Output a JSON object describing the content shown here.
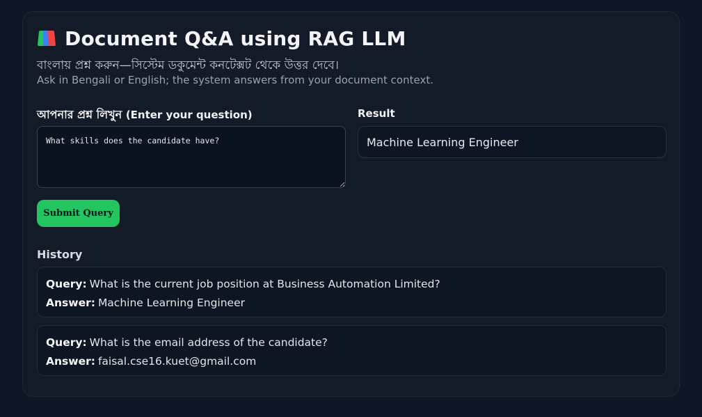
{
  "header": {
    "icon": "books-icon",
    "title": "Document Q&A using RAG LLM",
    "subtitle_bn": "বাংলায় প্রশ্ন করুন—সিস্টেম ডকুমেন্ট কনটেক্সট থেকে উত্তর দেবে।",
    "subtitle_en": "Ask in Bengali or English; the system answers from your document context."
  },
  "question": {
    "label_bn": "আপনার প্রশ্ন লিখুন",
    "label_en": "(Enter your question)",
    "value": "What skills does the candidate have?"
  },
  "submit": {
    "label": "Submit Query"
  },
  "result": {
    "label": "Result",
    "value": "Machine Learning Engineer"
  },
  "history": {
    "label": "History",
    "query_key": "Query:",
    "answer_key": "Answer:",
    "items": [
      {
        "query": "What is the current job position at Business Automation Limited?",
        "answer": "Machine Learning Engineer"
      },
      {
        "query": "What is the email address of the candidate?",
        "answer": "faisal.cse16.kuet@gmail.com"
      }
    ]
  },
  "colors": {
    "background": "#0f1625",
    "card": "#131a28",
    "accent": "#22c55e"
  }
}
